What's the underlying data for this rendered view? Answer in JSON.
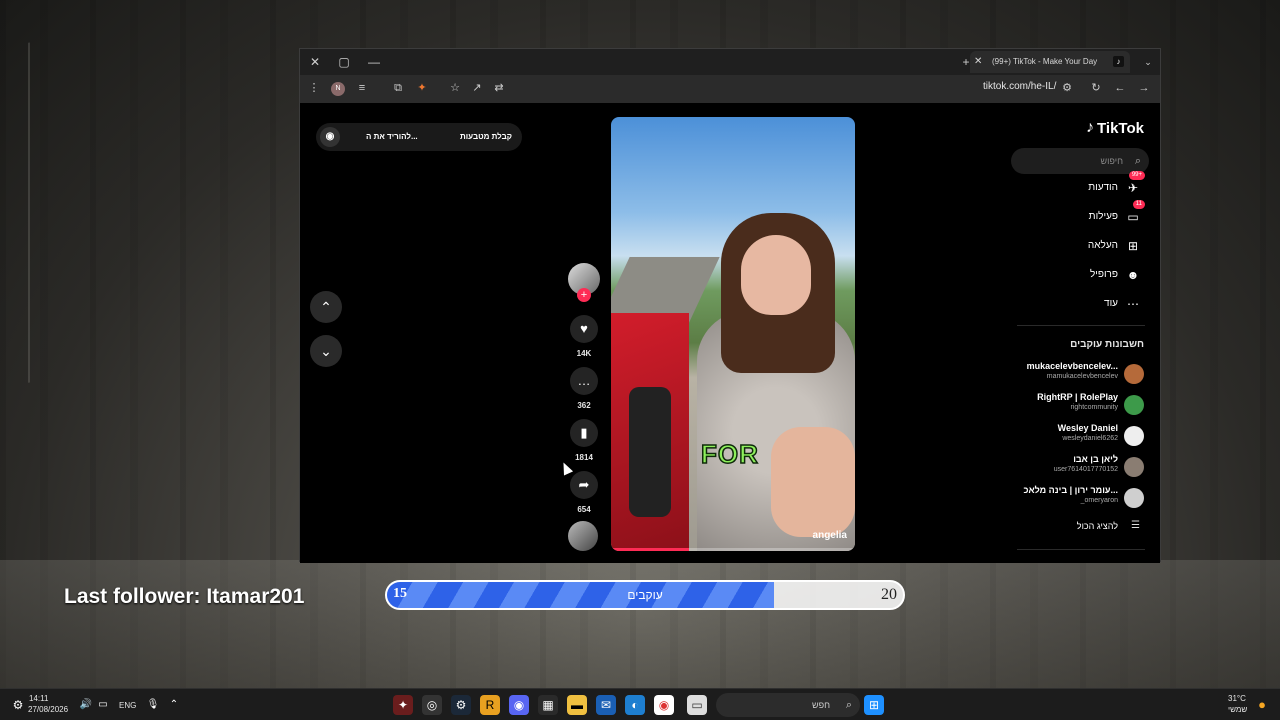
{
  "browser": {
    "tab_title": "(99+) TikTok - Make Your Day",
    "url": "tiktok.com/he-IL/",
    "window_controls": {
      "close": "✕",
      "maximize": "▢",
      "minimize": "—"
    },
    "new_tab": "+",
    "ext_badge": "N"
  },
  "tiktok": {
    "logo": "TikTok",
    "search_placeholder": "חיפוש",
    "nav": [
      {
        "label": "הודעות",
        "badge": "99+"
      },
      {
        "label": "פעילות",
        "badge": "11"
      },
      {
        "label": "העלאה",
        "badge": ""
      },
      {
        "label": "פרופיל",
        "badge": ""
      },
      {
        "label": "עוד",
        "badge": ""
      }
    ],
    "following_title": "חשבונות עוקבים",
    "following": [
      {
        "name": "mukacelevbencelev...",
        "user": "mamukacelevbencelev"
      },
      {
        "name": "RightRP | RolePlay",
        "user": "rightcommunity"
      },
      {
        "name": "Wesley Daniel",
        "user": "wesleydaniel6262"
      },
      {
        "name": "ליאן בן אבו",
        "user": "user7614017770152"
      },
      {
        "name": "עומר ירון | בינה מלאכ...",
        "user": "_omeryaron"
      }
    ],
    "show_all": "להציג הכול",
    "promo": {
      "text1": "קבלת מטבעות",
      "text2": "להוריד את ה..."
    },
    "video": {
      "caption": "FOR",
      "author": "angelia",
      "progress": 0.32
    },
    "actions": {
      "likes": "14K",
      "comments": "362",
      "saves": "1814",
      "shares": "654"
    }
  },
  "overlay": {
    "last_follower": "Last follower: Itamar201",
    "goal_label": "עוקבים",
    "goal_current": "15",
    "goal_target": "20",
    "goal_fill": 0.75
  },
  "taskbar": {
    "time": "14:11",
    "date": "27/08/2026",
    "lang": "ENG",
    "search": "חפש",
    "weather_temp": "31°C",
    "weather_desc": "שמשי"
  }
}
